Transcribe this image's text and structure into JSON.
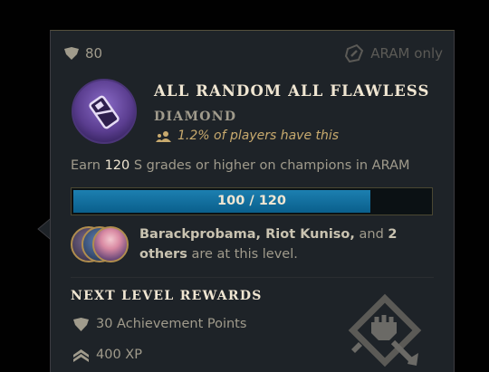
{
  "header": {
    "points_value": "80",
    "mode_label": "ARAM only"
  },
  "achievement": {
    "title": "ALL RANDOM ALL FLAWLESS",
    "tier": "DIAMOND",
    "rarity_text": "1.2% of players have this"
  },
  "description": {
    "prefix": "Earn ",
    "count": "120",
    "suffix": " S grades or higher on champions in ARAM"
  },
  "progress": {
    "label": "100 / 120",
    "fraction": 0.8333
  },
  "friends": {
    "names": "Barackprobama, Riot Kuniso,",
    "and_text": " and ",
    "others_count": "2",
    "others_word": "others",
    "suffix": " are at this level."
  },
  "rewards": {
    "title": "NEXT LEVEL REWARDS",
    "items": [
      {
        "icon": "achievement-points-icon",
        "label": "30 Achievement Points"
      },
      {
        "icon": "xp-chevron-icon",
        "label": "400 XP"
      }
    ]
  },
  "colors": {
    "gold": "#c8aa6e",
    "text_light": "#f0e6d2",
    "text_muted": "#a09b8c",
    "progress_blue": "#1c7fb0",
    "crest_purple": "#6a4aa0"
  }
}
